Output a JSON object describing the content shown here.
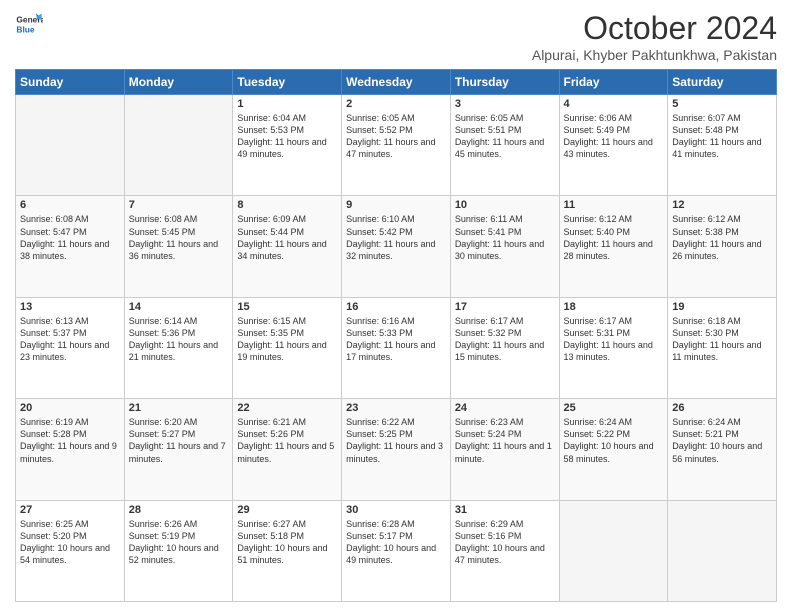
{
  "header": {
    "logo_general": "General",
    "logo_blue": "Blue",
    "month_title": "October 2024",
    "location": "Alpurai, Khyber Pakhtunkhwa, Pakistan"
  },
  "days_of_week": [
    "Sunday",
    "Monday",
    "Tuesday",
    "Wednesday",
    "Thursday",
    "Friday",
    "Saturday"
  ],
  "weeks": [
    [
      {
        "day": "",
        "sunrise": "",
        "sunset": "",
        "daylight": ""
      },
      {
        "day": "",
        "sunrise": "",
        "sunset": "",
        "daylight": ""
      },
      {
        "day": "1",
        "sunrise": "Sunrise: 6:04 AM",
        "sunset": "Sunset: 5:53 PM",
        "daylight": "Daylight: 11 hours and 49 minutes."
      },
      {
        "day": "2",
        "sunrise": "Sunrise: 6:05 AM",
        "sunset": "Sunset: 5:52 PM",
        "daylight": "Daylight: 11 hours and 47 minutes."
      },
      {
        "day": "3",
        "sunrise": "Sunrise: 6:05 AM",
        "sunset": "Sunset: 5:51 PM",
        "daylight": "Daylight: 11 hours and 45 minutes."
      },
      {
        "day": "4",
        "sunrise": "Sunrise: 6:06 AM",
        "sunset": "Sunset: 5:49 PM",
        "daylight": "Daylight: 11 hours and 43 minutes."
      },
      {
        "day": "5",
        "sunrise": "Sunrise: 6:07 AM",
        "sunset": "Sunset: 5:48 PM",
        "daylight": "Daylight: 11 hours and 41 minutes."
      }
    ],
    [
      {
        "day": "6",
        "sunrise": "Sunrise: 6:08 AM",
        "sunset": "Sunset: 5:47 PM",
        "daylight": "Daylight: 11 hours and 38 minutes."
      },
      {
        "day": "7",
        "sunrise": "Sunrise: 6:08 AM",
        "sunset": "Sunset: 5:45 PM",
        "daylight": "Daylight: 11 hours and 36 minutes."
      },
      {
        "day": "8",
        "sunrise": "Sunrise: 6:09 AM",
        "sunset": "Sunset: 5:44 PM",
        "daylight": "Daylight: 11 hours and 34 minutes."
      },
      {
        "day": "9",
        "sunrise": "Sunrise: 6:10 AM",
        "sunset": "Sunset: 5:42 PM",
        "daylight": "Daylight: 11 hours and 32 minutes."
      },
      {
        "day": "10",
        "sunrise": "Sunrise: 6:11 AM",
        "sunset": "Sunset: 5:41 PM",
        "daylight": "Daylight: 11 hours and 30 minutes."
      },
      {
        "day": "11",
        "sunrise": "Sunrise: 6:12 AM",
        "sunset": "Sunset: 5:40 PM",
        "daylight": "Daylight: 11 hours and 28 minutes."
      },
      {
        "day": "12",
        "sunrise": "Sunrise: 6:12 AM",
        "sunset": "Sunset: 5:38 PM",
        "daylight": "Daylight: 11 hours and 26 minutes."
      }
    ],
    [
      {
        "day": "13",
        "sunrise": "Sunrise: 6:13 AM",
        "sunset": "Sunset: 5:37 PM",
        "daylight": "Daylight: 11 hours and 23 minutes."
      },
      {
        "day": "14",
        "sunrise": "Sunrise: 6:14 AM",
        "sunset": "Sunset: 5:36 PM",
        "daylight": "Daylight: 11 hours and 21 minutes."
      },
      {
        "day": "15",
        "sunrise": "Sunrise: 6:15 AM",
        "sunset": "Sunset: 5:35 PM",
        "daylight": "Daylight: 11 hours and 19 minutes."
      },
      {
        "day": "16",
        "sunrise": "Sunrise: 6:16 AM",
        "sunset": "Sunset: 5:33 PM",
        "daylight": "Daylight: 11 hours and 17 minutes."
      },
      {
        "day": "17",
        "sunrise": "Sunrise: 6:17 AM",
        "sunset": "Sunset: 5:32 PM",
        "daylight": "Daylight: 11 hours and 15 minutes."
      },
      {
        "day": "18",
        "sunrise": "Sunrise: 6:17 AM",
        "sunset": "Sunset: 5:31 PM",
        "daylight": "Daylight: 11 hours and 13 minutes."
      },
      {
        "day": "19",
        "sunrise": "Sunrise: 6:18 AM",
        "sunset": "Sunset: 5:30 PM",
        "daylight": "Daylight: 11 hours and 11 minutes."
      }
    ],
    [
      {
        "day": "20",
        "sunrise": "Sunrise: 6:19 AM",
        "sunset": "Sunset: 5:28 PM",
        "daylight": "Daylight: 11 hours and 9 minutes."
      },
      {
        "day": "21",
        "sunrise": "Sunrise: 6:20 AM",
        "sunset": "Sunset: 5:27 PM",
        "daylight": "Daylight: 11 hours and 7 minutes."
      },
      {
        "day": "22",
        "sunrise": "Sunrise: 6:21 AM",
        "sunset": "Sunset: 5:26 PM",
        "daylight": "Daylight: 11 hours and 5 minutes."
      },
      {
        "day": "23",
        "sunrise": "Sunrise: 6:22 AM",
        "sunset": "Sunset: 5:25 PM",
        "daylight": "Daylight: 11 hours and 3 minutes."
      },
      {
        "day": "24",
        "sunrise": "Sunrise: 6:23 AM",
        "sunset": "Sunset: 5:24 PM",
        "daylight": "Daylight: 11 hours and 1 minute."
      },
      {
        "day": "25",
        "sunrise": "Sunrise: 6:24 AM",
        "sunset": "Sunset: 5:22 PM",
        "daylight": "Daylight: 10 hours and 58 minutes."
      },
      {
        "day": "26",
        "sunrise": "Sunrise: 6:24 AM",
        "sunset": "Sunset: 5:21 PM",
        "daylight": "Daylight: 10 hours and 56 minutes."
      }
    ],
    [
      {
        "day": "27",
        "sunrise": "Sunrise: 6:25 AM",
        "sunset": "Sunset: 5:20 PM",
        "daylight": "Daylight: 10 hours and 54 minutes."
      },
      {
        "day": "28",
        "sunrise": "Sunrise: 6:26 AM",
        "sunset": "Sunset: 5:19 PM",
        "daylight": "Daylight: 10 hours and 52 minutes."
      },
      {
        "day": "29",
        "sunrise": "Sunrise: 6:27 AM",
        "sunset": "Sunset: 5:18 PM",
        "daylight": "Daylight: 10 hours and 51 minutes."
      },
      {
        "day": "30",
        "sunrise": "Sunrise: 6:28 AM",
        "sunset": "Sunset: 5:17 PM",
        "daylight": "Daylight: 10 hours and 49 minutes."
      },
      {
        "day": "31",
        "sunrise": "Sunrise: 6:29 AM",
        "sunset": "Sunset: 5:16 PM",
        "daylight": "Daylight: 10 hours and 47 minutes."
      },
      {
        "day": "",
        "sunrise": "",
        "sunset": "",
        "daylight": ""
      },
      {
        "day": "",
        "sunrise": "",
        "sunset": "",
        "daylight": ""
      }
    ]
  ]
}
